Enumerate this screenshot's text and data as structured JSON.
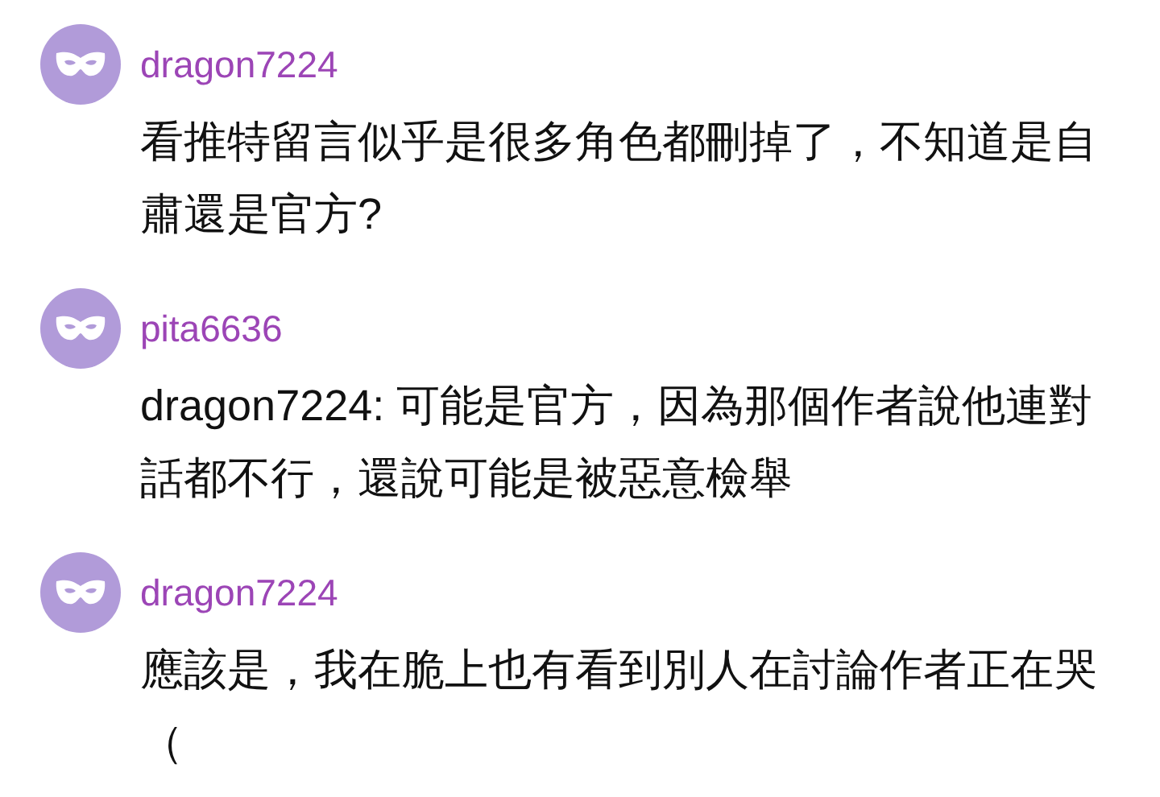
{
  "comments": [
    {
      "username": "dragon7224",
      "text": "看推特留言似乎是很多角色都刪掉了，不知道是自肅還是官方?"
    },
    {
      "username": "pita6636",
      "text": "dragon7224: 可能是官方，因為那個作者說他連對話都不行，還說可能是被惡意檢舉"
    },
    {
      "username": "dragon7224",
      "text": "應該是，我在脆上也有看到別人在討論作者正在哭（"
    }
  ]
}
